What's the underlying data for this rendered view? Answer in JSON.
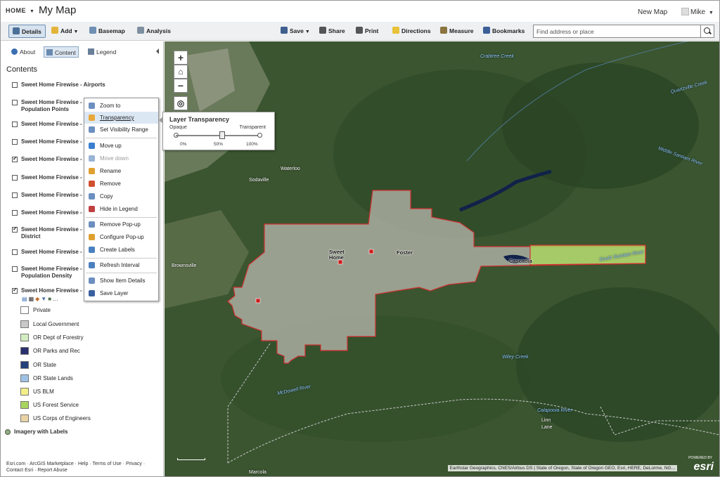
{
  "header": {
    "home": "HOME",
    "title": "My Map",
    "new_map": "New Map",
    "user": "Mike"
  },
  "toolbar": {
    "details": "Details",
    "add": "Add",
    "basemap": "Basemap",
    "analysis": "Analysis",
    "save": "Save",
    "share": "Share",
    "print": "Print",
    "directions": "Directions",
    "measure": "Measure",
    "bookmarks": "Bookmarks",
    "search_placeholder": "Find address or place"
  },
  "panel": {
    "tabs": {
      "about": "About",
      "content": "Content",
      "legend": "Legend"
    },
    "heading": "Contents",
    "layers": [
      {
        "label": "Sweet Home Firewise - Airports",
        "checked": false
      },
      {
        "label": "Sweet Home Firewise -",
        "label2": "Population Points",
        "checked": false
      },
      {
        "label": "Sweet Home Firewise -",
        "checked": false
      },
      {
        "label": "Sweet Home Firewise -",
        "checked": false
      },
      {
        "label": "Sweet Home Firewise -",
        "checked": true
      },
      {
        "label": "Sweet Home Firewise -",
        "checked": false
      },
      {
        "label": "Sweet Home Firewise -",
        "checked": false
      },
      {
        "label": "Sweet Home Firewise -",
        "checked": false
      },
      {
        "label": "Sweet Home Firewise -",
        "label2": "District",
        "checked": true
      },
      {
        "label": "Sweet Home Firewise -",
        "checked": false
      },
      {
        "label": "Sweet Home Firewise -",
        "label2": "Population Density",
        "checked": false
      },
      {
        "label": "Sweet Home Firewise -",
        "checked": true
      }
    ],
    "legend": [
      {
        "label": "Private",
        "color": "#ffffff"
      },
      {
        "label": "Local Government",
        "color": "#c8c8c8"
      },
      {
        "label": "OR Dept of Forestry",
        "color": "#d4edc0"
      },
      {
        "label": "OR Parks and Rec",
        "color": "#2a2f6e"
      },
      {
        "label": "OR State",
        "color": "#23407a"
      },
      {
        "label": "OR State Lands",
        "color": "#9fc1e6"
      },
      {
        "label": "US BLM",
        "color": "#f3ee8a"
      },
      {
        "label": "US Forest Service",
        "color": "#a9d45e"
      },
      {
        "label": "US Corps of Engineers",
        "color": "#e7d3a6"
      }
    ],
    "basemap_layer": "Imagery with Labels",
    "footer": [
      "Esri.com",
      "ArcGIS Marketplace",
      "Help",
      "Terms of Use",
      "Privacy",
      "Contact Esri",
      "Report Abuse"
    ]
  },
  "context_menu": [
    {
      "label": "Zoom to",
      "color": "#6c8fc0"
    },
    {
      "label": "Transparency",
      "color": "#e8a83a"
    },
    {
      "label": "Set Visibility Range",
      "color": "#6c8fc0"
    },
    {
      "label": "Move up",
      "color": "#3a7fd0"
    },
    {
      "label": "Move down",
      "color": "#9ab4d6"
    },
    {
      "label": "Rename",
      "color": "#e0a030"
    },
    {
      "label": "Remove",
      "color": "#d05030"
    },
    {
      "label": "Copy",
      "color": "#6c8fc0"
    },
    {
      "label": "Hide in Legend",
      "color": "#c04040"
    },
    {
      "label": "Remove Pop-up",
      "color": "#6c8fc0"
    },
    {
      "label": "Configure Pop-up",
      "color": "#e0a030"
    },
    {
      "label": "Create Labels",
      "color": "#4a80c0"
    },
    {
      "label": "Refresh Interval",
      "color": "#4a80c0"
    },
    {
      "label": "Show Item Details",
      "color": "#6c8fc0"
    },
    {
      "label": "Save Layer",
      "color": "#3a60a0"
    }
  ],
  "transparency_popup": {
    "title": "Layer Transparency",
    "left": "Opaque",
    "right": "Transparent",
    "ticks": [
      "0%",
      "50%",
      "100%"
    ],
    "value_percent": 55
  },
  "map": {
    "labels": [
      "Crabtree Creek",
      "Quartzville Creek",
      "Middle Santiam River",
      "South Santiam River",
      "Wiley Creek",
      "McDowell River",
      "Calapooia River",
      "Waterloo",
      "Sodaville",
      "Brownsville",
      "Sweet Home",
      "Foster",
      "Cascadia",
      "Marcola",
      "Linn",
      "Lane"
    ],
    "attribution": "Earthstar Geographics, CNES/Airbus DS | State of Oregon, State of Oregon GEO, Esri, HERE, DeLorme, NG...",
    "powered_by": "POWERED BY",
    "esri": "esri"
  }
}
